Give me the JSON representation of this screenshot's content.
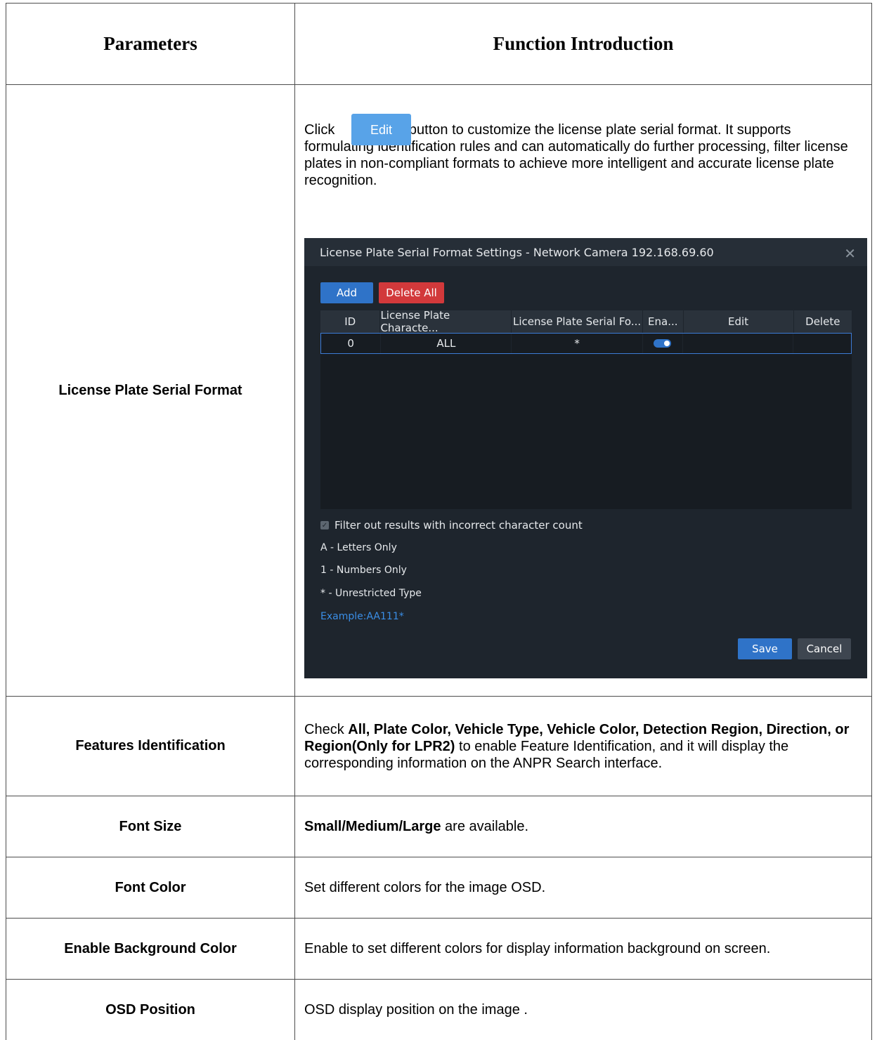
{
  "header": {
    "col1": "Parameters",
    "col2": "Function Introduction"
  },
  "rows": [
    {
      "param": "License Plate Serial Format",
      "intro_prefix": "Click",
      "edit_button": "Edit",
      "intro_suffix": "button to customize the license plate serial format. It supports formulating identification rules and can automatically do further processing, filter license plates in non-compliant formats to achieve more intelligent and accurate license plate recognition."
    },
    {
      "param": "Features Identification",
      "desc_prefix": "Check ",
      "desc_bold": "All, Plate Color, Vehicle Type, Vehicle Color, Detection Region, Direction, or Region(Only for LPR2)",
      "desc_suffix": " to enable Feature Identification, and it will display the corresponding information on the ANPR Search interface."
    },
    {
      "param": "Font Size",
      "desc_bold": "Small/Medium/Large",
      "desc_suffix": " are available."
    },
    {
      "param": "Font Color",
      "desc": "Set different colors for the image OSD."
    },
    {
      "param": "Enable Background Color",
      "desc": "Enable to set different colors for display information background on screen."
    },
    {
      "param": "OSD Position",
      "desc": "OSD display position on the image ."
    }
  ],
  "dialog": {
    "title": "License Plate Serial Format Settings - Network Camera 192.168.69.60",
    "close_icon": "close-icon",
    "add": "Add",
    "delete_all": "Delete All",
    "columns": [
      "ID",
      "License Plate Characte...",
      "License Plate Serial Fo...",
      "Ena...",
      "Edit",
      "Delete"
    ],
    "row": {
      "id": "0",
      "characters": "ALL",
      "format": "*",
      "enabled": true
    },
    "filter_label": "Filter out results with incorrect character count",
    "legend": [
      "A - Letters Only",
      "1 - Numbers Only",
      "* - Unrestricted Type"
    ],
    "example": "Example:AA111*",
    "save": "Save",
    "cancel": "Cancel",
    "colors": {
      "bg": "#1e252d",
      "primary": "#2f73c8",
      "danger": "#d2393b",
      "example": "#3a8ee6"
    }
  }
}
